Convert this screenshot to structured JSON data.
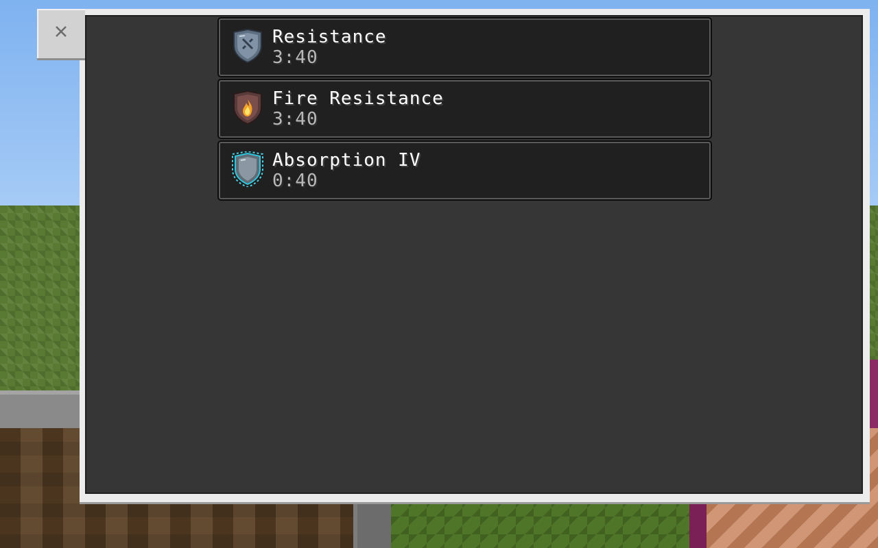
{
  "screen": {
    "close_icon": "close-icon"
  },
  "effects": [
    {
      "name": "Resistance",
      "duration": "3:40",
      "icon": "resistance-shield-icon"
    },
    {
      "name": "Fire Resistance",
      "duration": "3:40",
      "icon": "fire-resistance-shield-icon"
    },
    {
      "name": "Absorption IV",
      "duration": "0:40",
      "icon": "absorption-shield-icon"
    }
  ],
  "colors": {
    "panel_background": "#363636",
    "panel_frame": "#ececec",
    "row_background": "#202020",
    "name_text": "#ffffff",
    "duration_text": "#b8b8b8"
  }
}
